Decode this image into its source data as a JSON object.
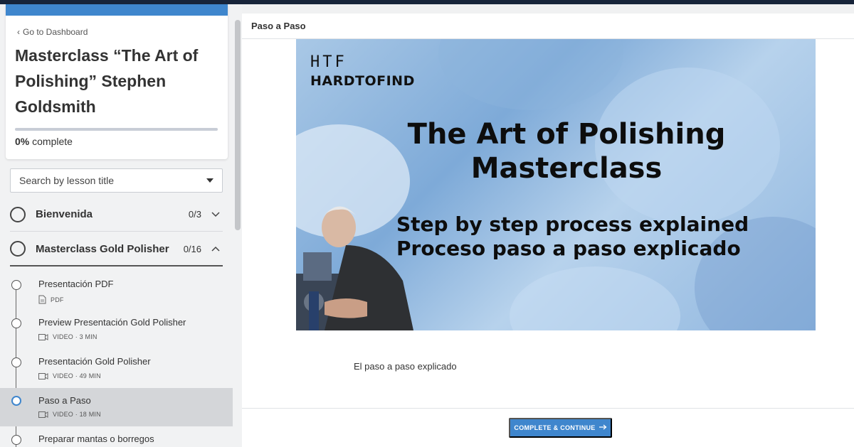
{
  "sidebar": {
    "back_label": "Go to Dashboard",
    "course_title": "Masterclass “The Art of Polishing” Stephen Goldsmith",
    "progress": {
      "percent": 0,
      "percent_label": "0%",
      "suffix": "complete"
    },
    "search": {
      "placeholder": "Search by lesson title"
    },
    "sections": [
      {
        "title": "Bienvenida",
        "count": "0/3",
        "expanded": false
      },
      {
        "title": "Masterclass Gold Polisher",
        "count": "0/16",
        "expanded": true
      }
    ],
    "lessons": [
      {
        "title": "Presentación PDF",
        "meta": "PDF",
        "icon": "pdf-icon",
        "active": false
      },
      {
        "title": "Preview Presentación Gold Polisher",
        "meta": "VIDEO · 3 MIN",
        "icon": "video-icon",
        "active": false
      },
      {
        "title": "Presentación Gold Polisher",
        "meta": "VIDEO · 49 MIN",
        "icon": "video-icon",
        "active": false
      },
      {
        "title": "Paso a Paso",
        "meta": "VIDEO · 18 MIN",
        "icon": "video-icon",
        "active": true
      },
      {
        "title": "Preparar mantas o borregos",
        "meta": "",
        "icon": "",
        "active": false
      }
    ]
  },
  "main": {
    "header_title": "Paso a Paso",
    "video": {
      "logo_mark": "HTF",
      "logo_name": "HARDTOFIND",
      "title_line1": "The Art of Polishing",
      "title_line2": "Masterclass",
      "subtitle_line1": "Step by step process explained",
      "subtitle_line2": "Proceso paso a paso explicado"
    },
    "description": "El paso a paso explicado",
    "cta_label": "COMPLETE & CONTINUE",
    "cta_icon": "arrow-right-icon"
  },
  "colors": {
    "accent": "#3f86cd",
    "topbar": "#17243a",
    "active_lesson_bg": "#d4d6d9"
  }
}
